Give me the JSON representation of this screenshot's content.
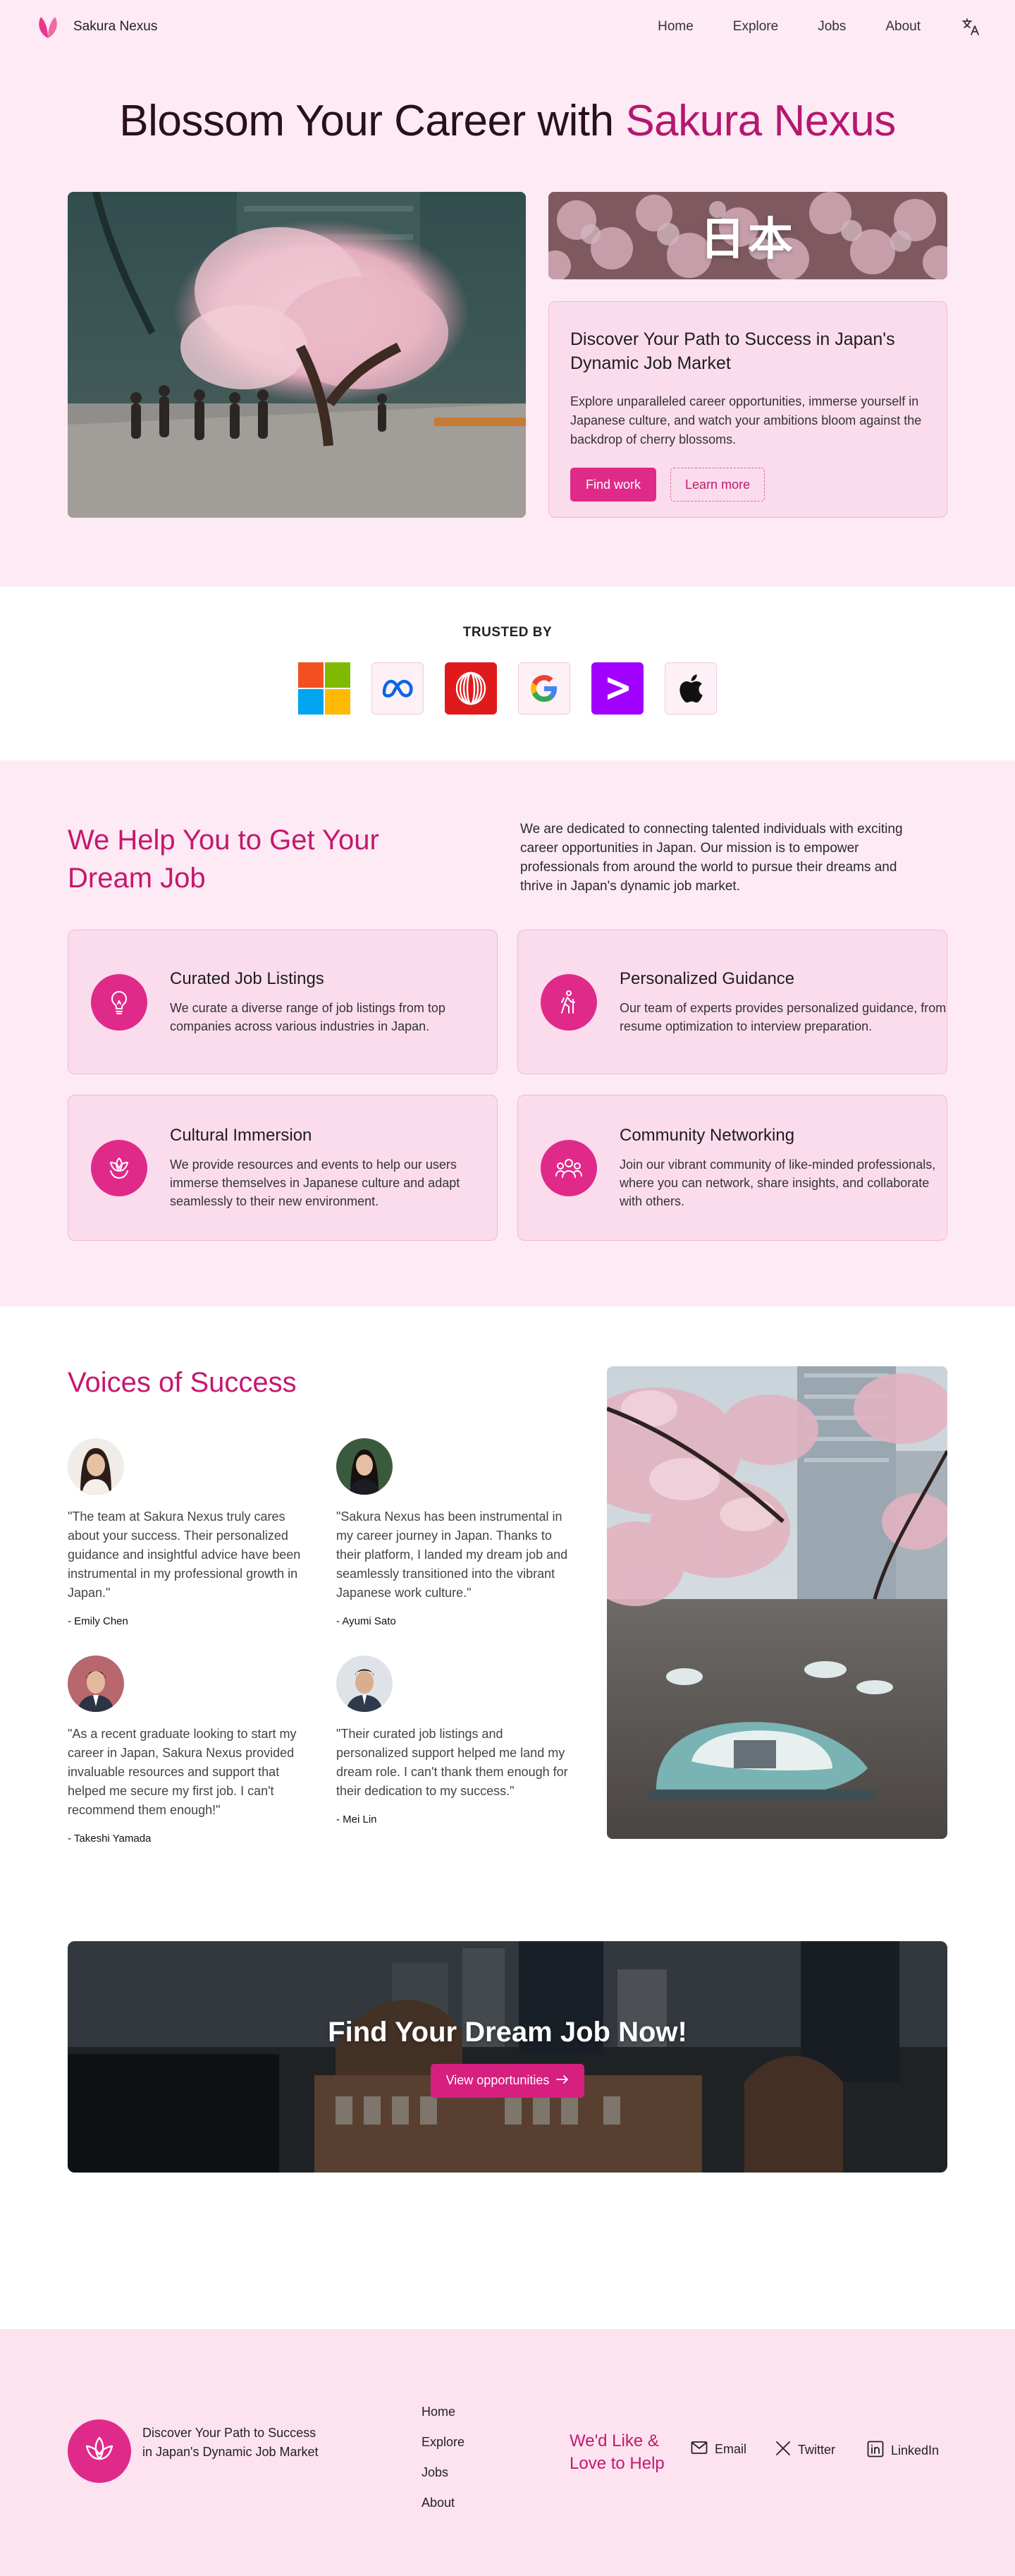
{
  "nav": {
    "brand": "Sakura Nexus",
    "links": [
      "Home",
      "Explore",
      "Jobs",
      "About"
    ],
    "language_icon": "translate-icon"
  },
  "hero": {
    "title_part1": "Blossom Your Career with ",
    "title_accent": "Sakura Nexus",
    "kanji": "日本",
    "card_title": "Discover Your Path to Success in Japan's Dynamic Job Market",
    "card_text": "Explore unparalleled career opportunities, immerse yourself in Japanese culture, and watch your ambitions bloom against the backdrop of cherry blossoms.",
    "primary_button": "Find work",
    "secondary_button": "Learn more"
  },
  "trusted": {
    "heading": "TRUSTED BY",
    "logos": [
      "microsoft-logo",
      "meta-logo",
      "accenture-logo",
      "google-logo",
      "accenture-arrow-logo",
      "apple-logo"
    ]
  },
  "help": {
    "title": "We Help You to Get Your Dream Job",
    "intro": "We are dedicated to connecting talented individuals with exciting career opportunities in Japan. Our mission is to empower professionals from around the world to pursue their dreams and thrive in Japan's dynamic job market.",
    "features": [
      {
        "title": "Curated Job Listings",
        "text": "We curate a diverse range of job listings from top companies across various industries in Japan.",
        "icon": "lightbulb-icon"
      },
      {
        "title": "Personalized Guidance",
        "text": "Our team of experts provides personalized guidance, from resume optimization to interview preparation.",
        "icon": "hiker-icon"
      },
      {
        "title": "Cultural Immersion",
        "text": "We provide resources and events to help our users immerse themselves in Japanese culture and adapt seamlessly to their new environment.",
        "icon": "lotus-icon"
      },
      {
        "title": "Community Networking",
        "text": "Join our vibrant community of like-minded professionals, where you can network, share insights, and collaborate with others.",
        "icon": "people-icon"
      }
    ]
  },
  "voices": {
    "title": "Voices of Success",
    "testimonials": [
      {
        "quote": "\"The team at Sakura Nexus truly cares about your success. Their personalized guidance and insightful advice have been instrumental in my professional growth in Japan.\"",
        "author": "- Emily Chen"
      },
      {
        "quote": "\"Sakura Nexus has been instrumental in my career journey in Japan. Thanks to their platform, I landed my dream job and seamlessly transitioned into the vibrant Japanese work culture.\"",
        "author": "- Ayumi Sato"
      },
      {
        "quote": "\"As a recent graduate looking to start my career in Japan, Sakura Nexus provided invaluable resources and support that helped me secure my first job. I can't recommend them enough!\"",
        "author": "- Takeshi Yamada"
      },
      {
        "quote": "\"Their curated job listings and personalized support helped me land my dream role. I can't thank them enough for their dedication to my success.\"",
        "author": "- Mei Lin"
      }
    ]
  },
  "cta": {
    "title": "Find Your Dream Job Now!",
    "button": "View opportunities"
  },
  "footer": {
    "tagline": "Discover Your Path to Success in Japan's Dynamic Job Market",
    "links": [
      "Home",
      "Explore",
      "Jobs",
      "About"
    ],
    "contact_title": "We'd Like & Love to Help",
    "social": [
      {
        "label": "Email",
        "icon": "mail-icon"
      },
      {
        "label": "Twitter",
        "icon": "x-icon"
      },
      {
        "label": "LinkedIn",
        "icon": "linkedin-icon"
      }
    ]
  },
  "colors": {
    "accent": "#e02a8a",
    "heading_pink": "#c4186e",
    "section_bg": "#fdeaf4",
    "card_bg": "#fbdcec"
  }
}
